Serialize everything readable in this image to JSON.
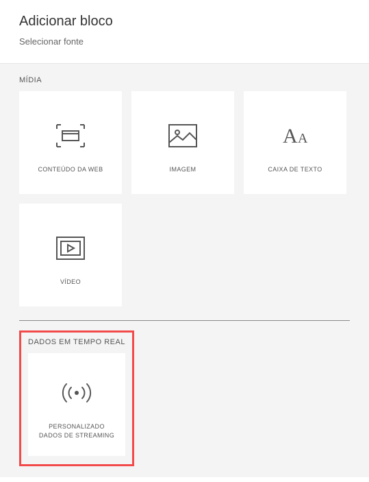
{
  "header": {
    "title": "Adicionar bloco",
    "subtitle": "Selecionar fonte"
  },
  "sections": {
    "media": {
      "label": "MÍDIA",
      "tiles": {
        "web": "CONTEÚDO DA WEB",
        "image": "IMAGEM",
        "textbox": "CAIXA DE TEXTO",
        "video": "VÍDEO"
      }
    },
    "realtime": {
      "label": "DADOS EM TEMPO REAL",
      "tiles": {
        "streaming_line1": "PERSONALIZADO",
        "streaming_line2": "DADOS DE STREAMING"
      }
    }
  }
}
